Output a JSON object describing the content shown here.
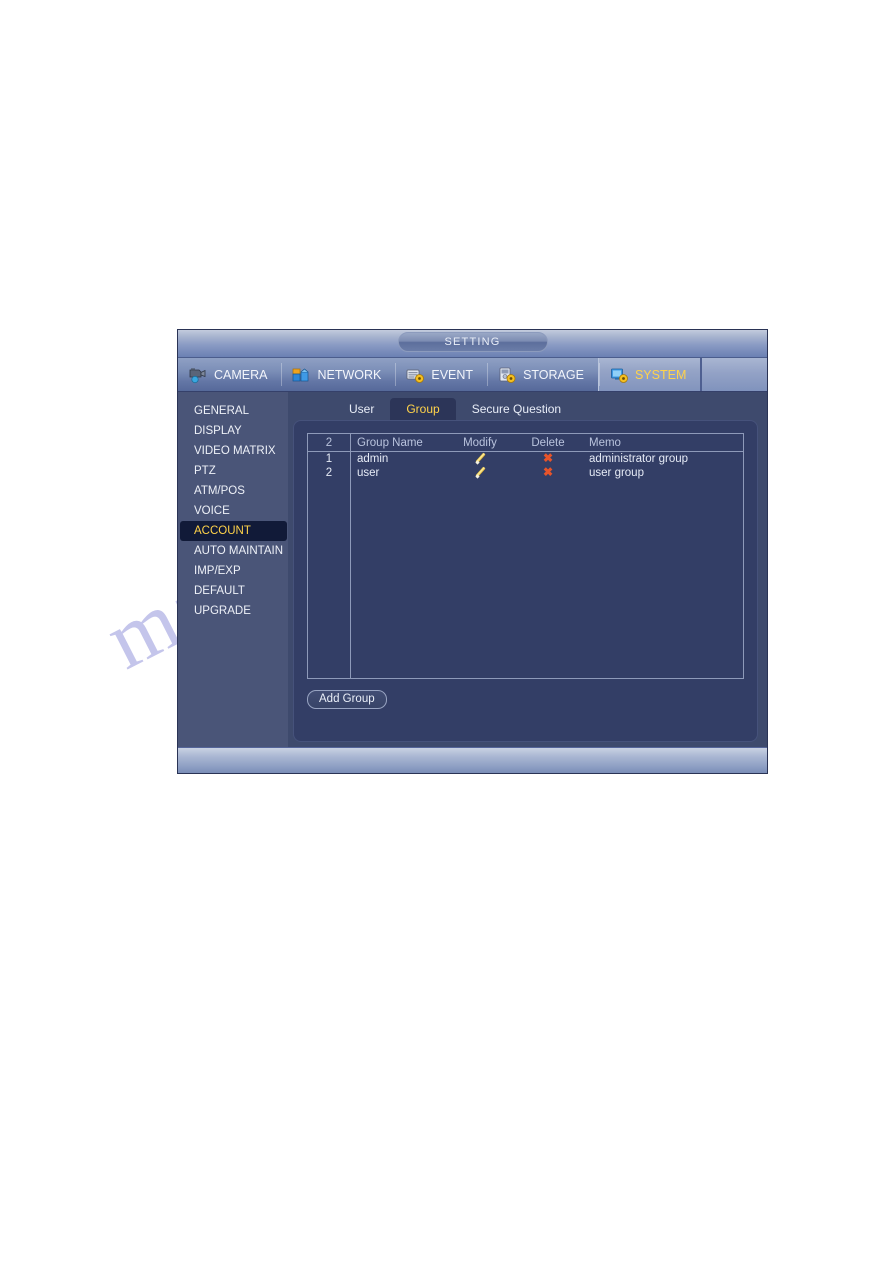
{
  "window": {
    "title": "SETTING"
  },
  "main_tabs": [
    {
      "label": "CAMERA",
      "icon": "camera-icon",
      "selected": false
    },
    {
      "label": "NETWORK",
      "icon": "network-icon",
      "selected": false
    },
    {
      "label": "EVENT",
      "icon": "event-icon",
      "selected": false
    },
    {
      "label": "STORAGE",
      "icon": "storage-icon",
      "selected": false
    },
    {
      "label": "SYSTEM",
      "icon": "system-icon",
      "selected": true
    }
  ],
  "sidebar": {
    "items": [
      {
        "label": "GENERAL",
        "selected": false
      },
      {
        "label": "DISPLAY",
        "selected": false
      },
      {
        "label": "VIDEO MATRIX",
        "selected": false
      },
      {
        "label": "PTZ",
        "selected": false
      },
      {
        "label": "ATM/POS",
        "selected": false
      },
      {
        "label": "VOICE",
        "selected": false
      },
      {
        "label": "ACCOUNT",
        "selected": true
      },
      {
        "label": "AUTO MAINTAIN",
        "selected": false
      },
      {
        "label": "IMP/EXP",
        "selected": false
      },
      {
        "label": "DEFAULT",
        "selected": false
      },
      {
        "label": "UPGRADE",
        "selected": false
      }
    ]
  },
  "sub_tabs": [
    {
      "label": "User",
      "selected": false
    },
    {
      "label": "Group",
      "selected": true
    },
    {
      "label": "Secure Question",
      "selected": false
    }
  ],
  "table": {
    "headers": {
      "count": "2",
      "group_name": "Group Name",
      "modify": "Modify",
      "delete": "Delete",
      "memo": "Memo"
    },
    "rows": [
      {
        "index": "1",
        "group_name": "admin",
        "modify_icon": "pencil-icon",
        "delete_icon": "x-icon",
        "memo": "administrator group"
      },
      {
        "index": "2",
        "group_name": "user",
        "modify_icon": "pencil-icon",
        "delete_icon": "x-icon",
        "memo": "user group"
      }
    ]
  },
  "buttons": {
    "add_group": "Add Group"
  },
  "watermark": {
    "text": "manualshive.com"
  },
  "colors": {
    "accent_yellow": "#ffd34a",
    "window_body": "#3e4a6d",
    "sidebar": "#4a5578",
    "panel": "#333e66",
    "selected_item": "#111a38",
    "delete_icon": "#e8542a",
    "modify_icon": "#e8c23a"
  }
}
